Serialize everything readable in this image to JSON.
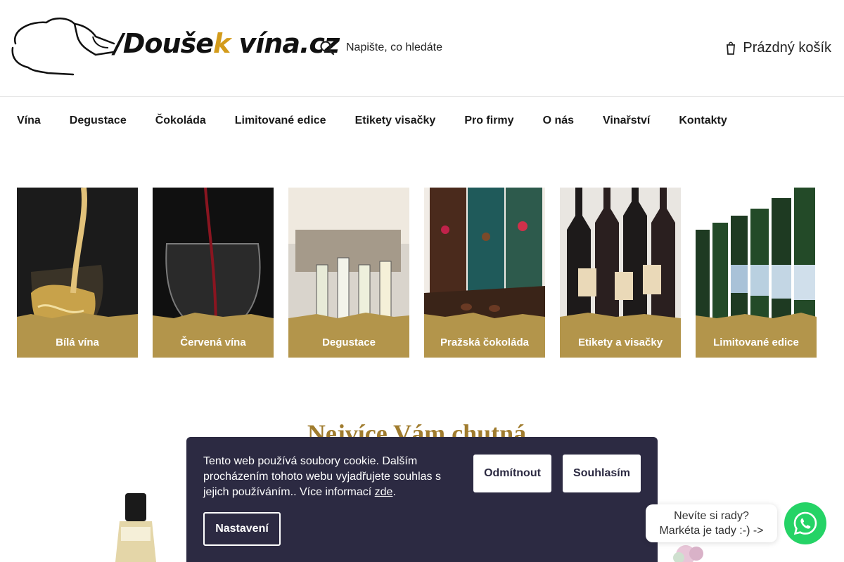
{
  "header": {
    "logo": {
      "text_main": "Doušek",
      "text_accent": "k",
      "text_tail": "vína.cz",
      "alt": "Doušek vína.cz"
    },
    "search": {
      "placeholder": "Napište, co hledáte",
      "icon": "search-icon"
    },
    "cart": {
      "label": "Prázdný košík",
      "icon": "cart-icon"
    }
  },
  "nav": {
    "items": [
      {
        "label": "Vína"
      },
      {
        "label": "Degustace"
      },
      {
        "label": "Čokoláda"
      },
      {
        "label": "Limitované edice"
      },
      {
        "label": "Etikety visačky"
      },
      {
        "label": "Pro firmy"
      },
      {
        "label": "O nás"
      },
      {
        "label": "Vinařství"
      },
      {
        "label": "Kontakty"
      }
    ]
  },
  "categories": [
    {
      "label": "Bílá vína"
    },
    {
      "label": "Červená vína"
    },
    {
      "label": "Degustace"
    },
    {
      "label": "Pražská čokoláda"
    },
    {
      "label": "Etikety a visačky"
    },
    {
      "label": "Limitované edice"
    }
  ],
  "section": {
    "title": "Nejvíce Vám chutná"
  },
  "cookie": {
    "text": "Tento web používá soubory cookie. Dalším procházením tohoto webu vyjadřujete souhlas s jejich používáním.. Více informací ",
    "link_text": "zde",
    "after_link": ".",
    "decline_label": "Odmítnout",
    "accept_label": "Souhlasím",
    "settings_label": "Nastavení"
  },
  "chat": {
    "line1": "Nevíte si rady?",
    "line2": "Markéta je tady :-) ->",
    "icon": "whatsapp-icon"
  },
  "colors": {
    "accent_gold": "#b3954b",
    "title_gold": "#a07c2e",
    "cookie_bg": "#2c2a42",
    "whatsapp_green": "#25d366"
  }
}
